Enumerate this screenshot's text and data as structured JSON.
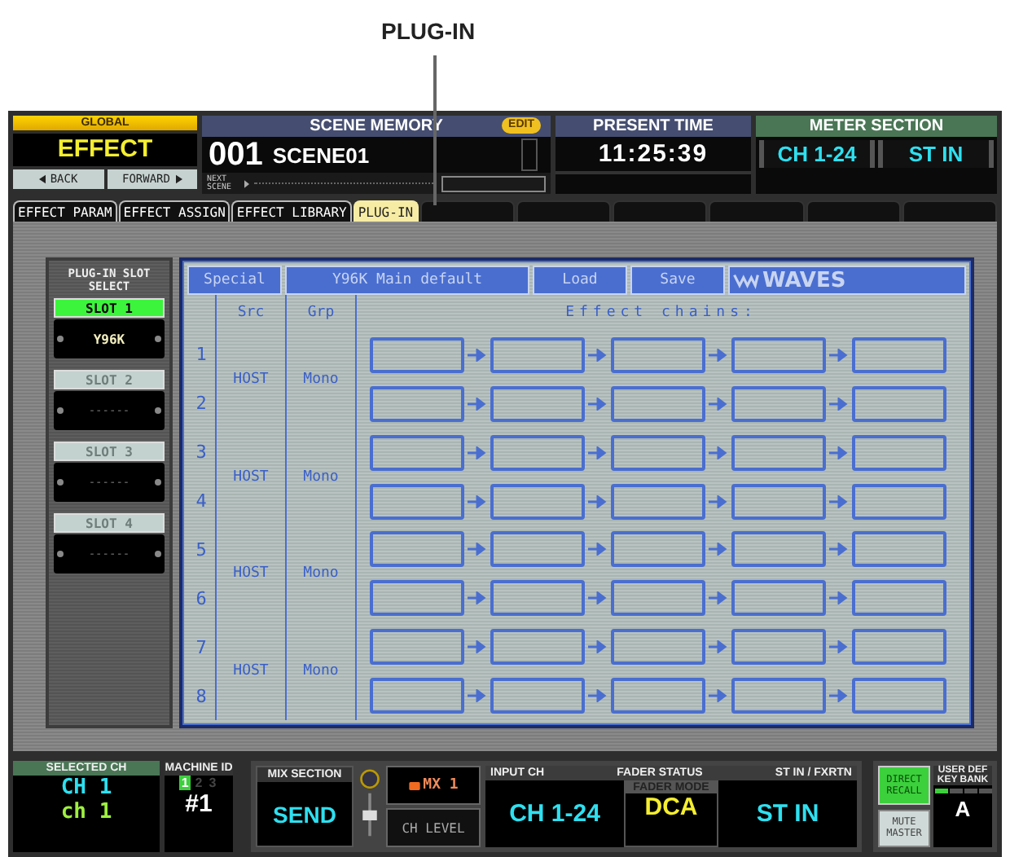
{
  "callout": {
    "label": "PLUG-IN"
  },
  "global": {
    "header": "GLOBAL",
    "value": "EFFECT",
    "buttons": [
      {
        "kind": "back",
        "label": "BACK"
      },
      {
        "kind": "forward",
        "label": "FORWARD"
      }
    ]
  },
  "scene_memory": {
    "title": "SCENE MEMORY",
    "badge": "EDIT",
    "number": "001",
    "name": "SCENE01",
    "next_label": "NEXT SCENE"
  },
  "present_time": {
    "title": "PRESENT TIME",
    "time": "11:25:39"
  },
  "meter_section": {
    "title": "METER SECTION",
    "buttons": [
      "CH 1-24",
      "ST IN"
    ]
  },
  "tabs": [
    {
      "label": "EFFECT PARAM",
      "selected": false
    },
    {
      "label": "EFFECT ASSIGN",
      "selected": false
    },
    {
      "label": "EFFECT LIBRARY",
      "selected": false
    },
    {
      "label": "PLUG-IN",
      "selected": true
    }
  ],
  "slot_select": {
    "title": "PLUG-IN SLOT SELECT",
    "slots": [
      {
        "label": "SLOT 1",
        "selected": true,
        "plugin": "Y96K"
      },
      {
        "label": "SLOT 2",
        "selected": false,
        "plugin": "------"
      },
      {
        "label": "SLOT 3",
        "selected": false,
        "plugin": "------"
      },
      {
        "label": "SLOT 4",
        "selected": false,
        "plugin": "------"
      }
    ]
  },
  "plugin_panel": {
    "toolbar": [
      "Special",
      "Y96K Main default",
      "Load",
      "Save"
    ],
    "logo": "WAVES",
    "columns": {
      "source": "Src",
      "group": "Grp",
      "chains": "Effect chains:"
    },
    "groups": [
      {
        "source": "HOST",
        "group": "Mono",
        "channels": [
          "1",
          "2"
        ]
      },
      {
        "source": "HOST",
        "group": "Mono",
        "channels": [
          "3",
          "4"
        ]
      },
      {
        "source": "HOST",
        "group": "Mono",
        "channels": [
          "5",
          "6"
        ]
      },
      {
        "source": "HOST",
        "group": "Mono",
        "channels": [
          "7",
          "8"
        ]
      }
    ]
  },
  "bottom_bar": {
    "selected_ch": {
      "title": "SELECTED CH",
      "line_1": "CH 1",
      "line_2": "ch 1"
    },
    "machine_id": {
      "title": "MACHINE ID",
      "ids": [
        {
          "label": "1",
          "selected": true
        },
        {
          "label": "2",
          "selected": false
        },
        {
          "label": "3",
          "selected": false
        }
      ],
      "value": "#1"
    },
    "mix_section": {
      "title": "MIX SECTION",
      "value": "SEND",
      "mix_label": "MX 1",
      "level_label": "CH LEVEL"
    },
    "fader_status": {
      "left_label": "INPUT CH",
      "title": "FADER STATUS",
      "right_label": "ST IN / FXRTN",
      "left_value": "CH 1-24",
      "mode_label": "FADER MODE",
      "mode_value": "DCA",
      "right_value": "ST IN"
    },
    "direct_recall": "DIRECT RECALL",
    "mute_master": "MUTE MASTER",
    "user_def": {
      "title": "USER DEF KEY BANK",
      "banks": [
        {
          "on": true
        },
        {
          "on": false
        },
        {
          "on": false
        },
        {
          "on": false
        }
      ],
      "value": "A"
    }
  }
}
